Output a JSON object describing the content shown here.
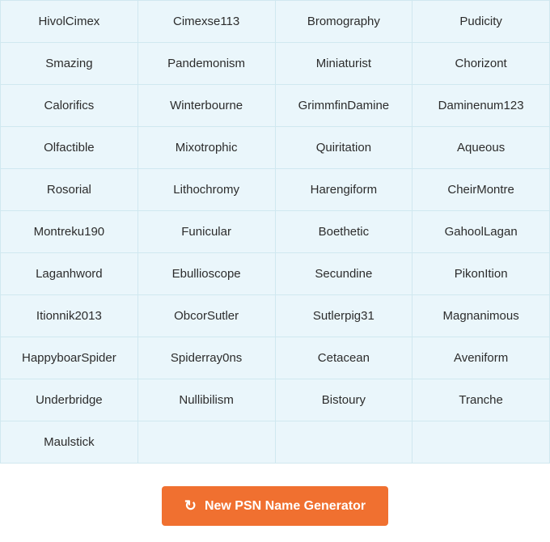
{
  "grid": {
    "cells": [
      "HivolCimex",
      "Cimexse113",
      "Bromography",
      "Pudicity",
      "Smazing",
      "Pandemonism",
      "Miniaturist",
      "Chorizont",
      "Calorifics",
      "Winterbourne",
      "GrimmfinDamine",
      "Daminenum123",
      "Olfactible",
      "Mixotrophic",
      "Quiritation",
      "Aqueous",
      "Rosorial",
      "Lithochromy",
      "Harengiform",
      "CheirMontre",
      "Montreku190",
      "Funicular",
      "Boethetic",
      "GahoolLagan",
      "Laganhword",
      "Ebullioscope",
      "Secundine",
      "PikonItion",
      "Itionnik2013",
      "ObcorSutler",
      "Sutlerpig31",
      "Magnanimous",
      "HappyboarSpider",
      "Spiderray0ns",
      "Cetacean",
      "Aveniform",
      "Underbridge",
      "Nullibilism",
      "Bistoury",
      "Tranche",
      "Maulstick",
      "",
      "",
      ""
    ],
    "columns": 4
  },
  "button": {
    "label": "New PSN Name Generator",
    "icon": "refresh-icon"
  }
}
